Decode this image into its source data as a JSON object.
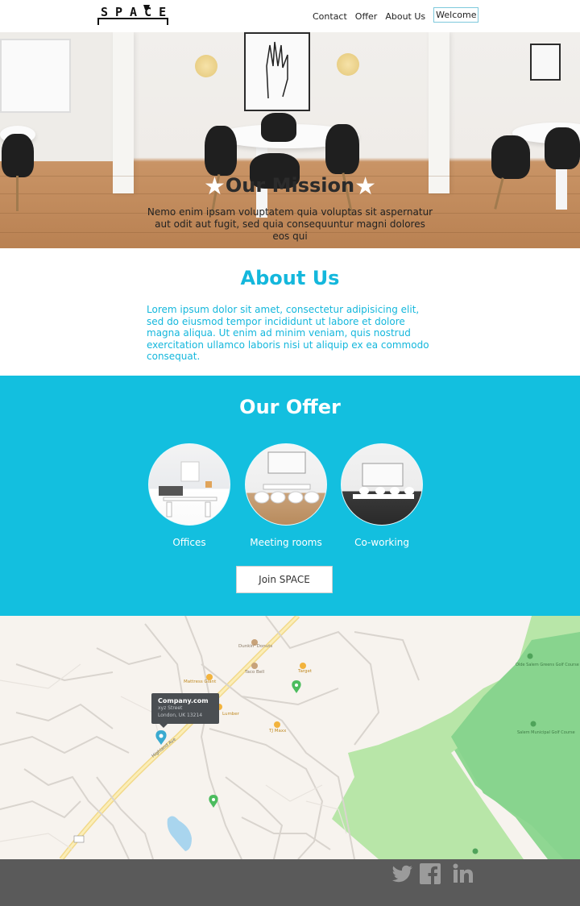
{
  "nav": {
    "logo_text": "SPACE",
    "links": [
      {
        "label": "Contact"
      },
      {
        "label": "Offer"
      },
      {
        "label": "About Us"
      },
      {
        "label": "Welcome"
      }
    ]
  },
  "hero": {
    "title": "Our Mission",
    "text": "Nemo enim ipsam voluptatem quia voluptas sit aspernatur aut odit aut fugit, sed quia consequuntur magni dolores eos qui"
  },
  "about": {
    "title": "About Us",
    "text": "Lorem ipsum dolor sit amet, consectetur adipisicing elit, sed do eiusmod tempor incididunt ut labore et dolore magna aliqua. Ut enim ad minim veniam, quis nostrud exercitation ullamco laboris nisi ut aliquip ex ea commodo consequat."
  },
  "offer": {
    "title": "Our Offer",
    "items": [
      {
        "label": "Offices"
      },
      {
        "label": "Meeting rooms"
      },
      {
        "label": "Co-working"
      }
    ],
    "button_label": "Join SPACE"
  },
  "map": {
    "popup_title": "Company.com",
    "popup_street": "xyz Street",
    "popup_city": "London, UK 13214",
    "labels": {
      "dunkin": "Dunkin' Donuts",
      "taco": "Taco Bell",
      "target": "Target",
      "mattress": "Mattress Giant",
      "lumber": "Lumber",
      "tjmaxx": "TJ Maxx",
      "highland": "Highland Ave",
      "golf1": "Olde Salem Greens Golf Course",
      "golf2": "Salem Municipal Golf Course"
    }
  },
  "footer": {
    "icons": [
      "twitter-icon",
      "facebook-icon",
      "linkedin-icon"
    ]
  },
  "colors": {
    "accent": "#13bfdf",
    "footer": "#5a5a5a"
  }
}
